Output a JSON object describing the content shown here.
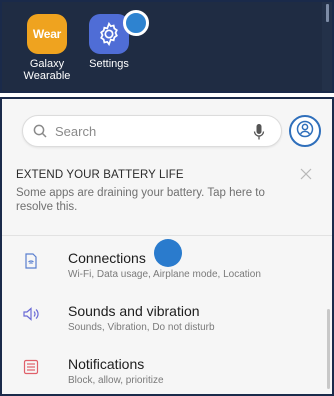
{
  "launcher": {
    "apps": [
      {
        "label": "Galaxy\nWearable",
        "icon_text": "Wear",
        "icon": "galaxy-wearable-icon"
      },
      {
        "label": "Settings",
        "icon": "gear-icon"
      }
    ]
  },
  "settings": {
    "search": {
      "placeholder": "Search"
    },
    "battery_card": {
      "title": "EXTEND YOUR BATTERY LIFE",
      "description": "Some apps are draining your battery. Tap here to resolve this."
    },
    "items": [
      {
        "title": "Connections",
        "subtitle": "Wi-Fi, Data usage, Airplane mode, Location",
        "icon": "connections-icon"
      },
      {
        "title": "Sounds and vibration",
        "subtitle": "Sounds, Vibration, Do not disturb",
        "icon": "speaker-icon"
      },
      {
        "title": "Notifications",
        "subtitle": "Block, allow, prioritize",
        "icon": "notifications-icon"
      }
    ]
  },
  "colors": {
    "launcher_bg": "#1f2c43",
    "wear_icon": "#efa31f",
    "settings_icon": "#4f6dd6",
    "touch_dot": "#2e83d0",
    "accent": "#2f6fbb"
  }
}
